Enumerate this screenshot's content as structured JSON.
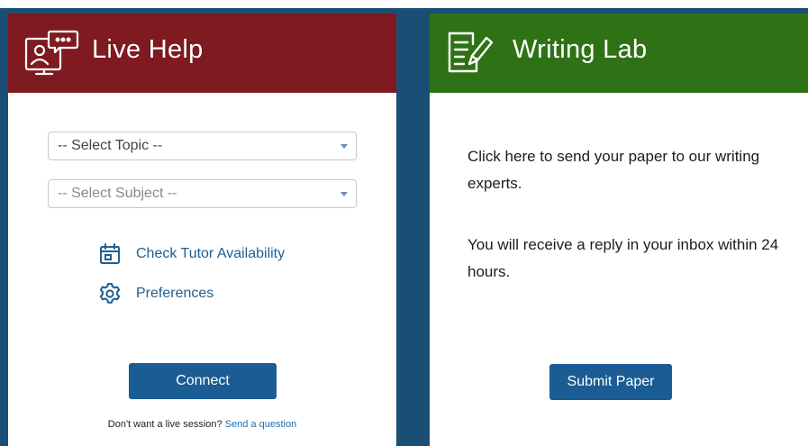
{
  "live_help": {
    "title": "Live Help",
    "topic_select": {
      "selected": "-- Select Topic --"
    },
    "subject_select": {
      "selected": "-- Select Subject --"
    },
    "check_availability_label": "Check Tutor Availability",
    "preferences_label": "Preferences",
    "connect_label": "Connect",
    "footnote_text": "Don't want a live session?",
    "footnote_link": "Send a question",
    "header_color": "#7e1a20"
  },
  "writing_lab": {
    "title": "Writing Lab",
    "paragraph_1": "Click here to send your paper to our writing experts.",
    "paragraph_2": "You will receive a reply in your inbox within 24 hours.",
    "submit_label": "Submit Paper",
    "header_color": "#2f7216"
  },
  "colors": {
    "background": "#1b4e74",
    "button": "#1b5c94",
    "link": "#1f5f91"
  },
  "icons": {
    "live_help": "chat-monitor-icon",
    "writing_lab": "document-pencil-icon",
    "availability": "calendar-icon",
    "preferences": "gear-icon",
    "dropdown": "chevron-down-icon"
  }
}
